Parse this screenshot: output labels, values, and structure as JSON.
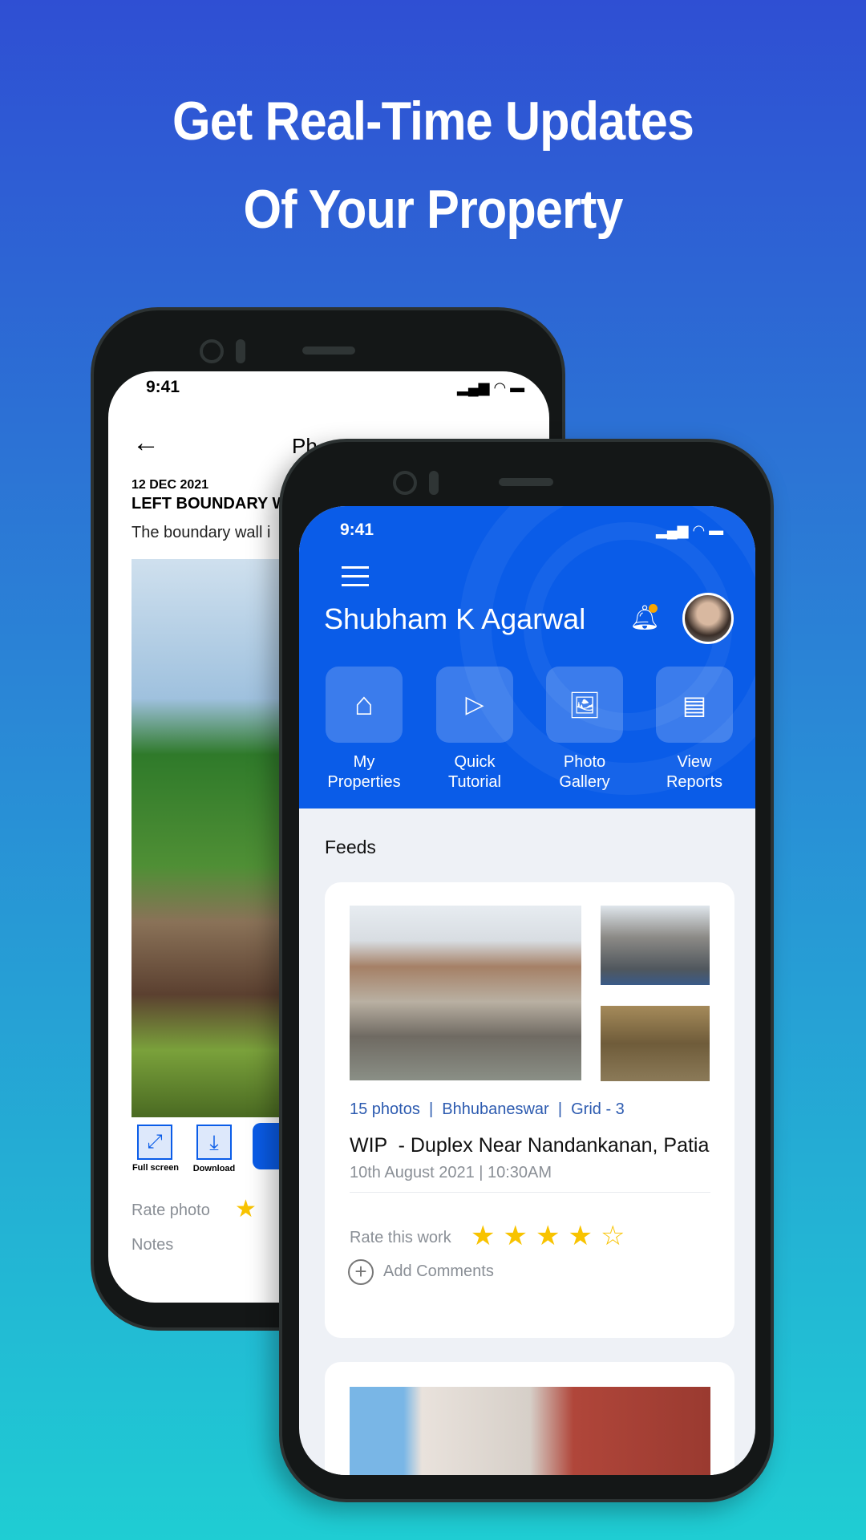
{
  "headline": {
    "line1": "Get Real-Time Updates",
    "line2": "Of Your Property"
  },
  "back_phone": {
    "time": "9:41",
    "title": "Ph",
    "date": "12 DEC 2021",
    "heading": "LEFT BOUNDARY W",
    "description": "The boundary wall i",
    "actions": [
      {
        "label": "Full screen",
        "icon": "fullscreen-icon"
      },
      {
        "label": "Download",
        "icon": "download-icon"
      }
    ],
    "rate_label": "Rate photo",
    "notes_label": "Notes"
  },
  "front_phone": {
    "time": "9:41",
    "user_name": "Shubham K Agarwal",
    "tiles": [
      {
        "line1": "My",
        "line2": "Properties",
        "icon": "home-icon"
      },
      {
        "line1": "Quick",
        "line2": "Tutorial",
        "icon": "play-icon"
      },
      {
        "line1": "Photo",
        "line2": "Gallery",
        "icon": "gallery-icon"
      },
      {
        "line1": "View",
        "line2": "Reports",
        "icon": "report-icon"
      }
    ],
    "feeds_label": "Feeds",
    "feed": {
      "meta": "15 photos  |  Bhhubaneswar  |  Grid - 3",
      "title": "WIP  - Duplex Near Nandankanan, Patia",
      "datetime": "10th August 2021 | 10:30AM",
      "rate_label": "Rate this work",
      "rating": 4,
      "rating_max": 5,
      "add_comments": "Add Comments"
    }
  },
  "colors": {
    "primary": "#0a5ce8",
    "star": "#f8c300",
    "meta": "#2d5bb0"
  }
}
